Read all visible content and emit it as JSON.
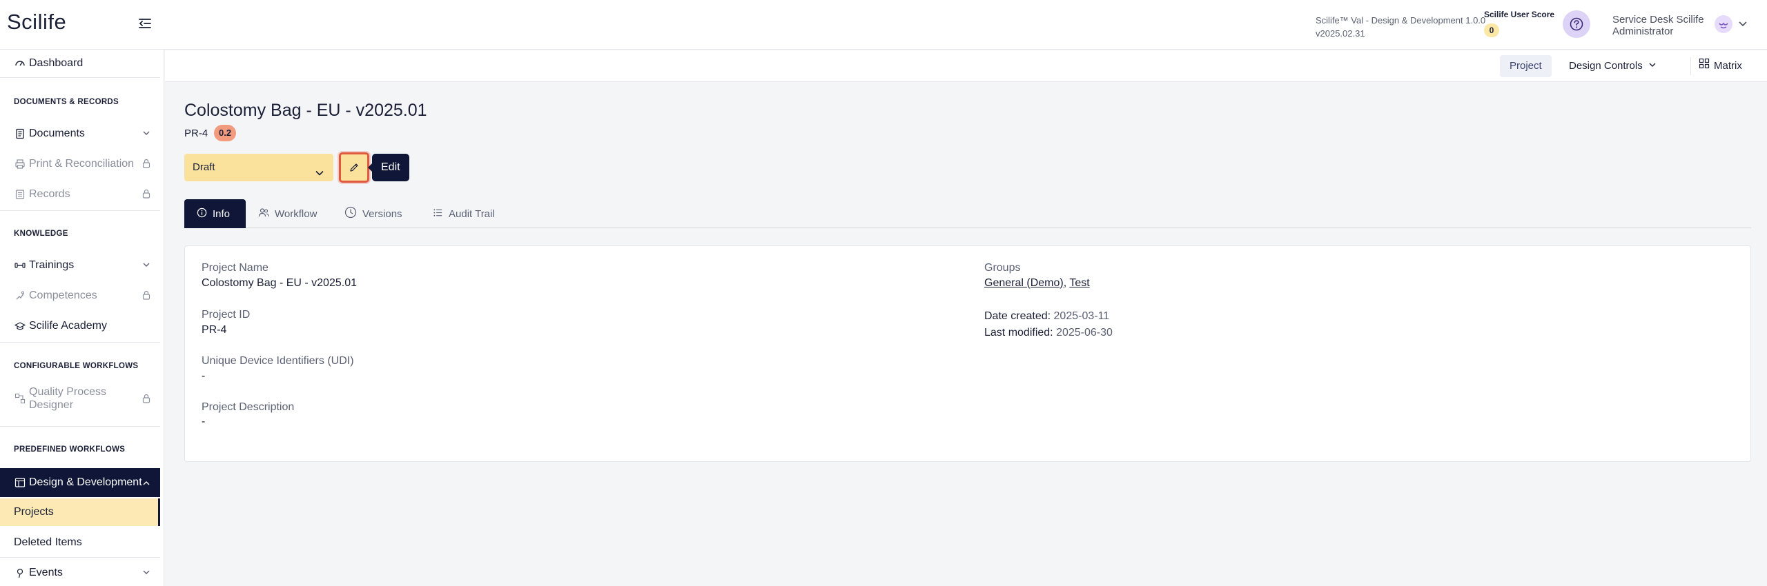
{
  "header": {
    "logo": "Scilife",
    "app_name": "Scilife™ Val - Design & Development 1.0.0",
    "app_version": "v2025.02.31",
    "score_label": "Scilife User Score",
    "score_value": "0",
    "user_line1": "Service Desk Scilife",
    "user_line2": "Administrator"
  },
  "sidebar": {
    "dashboard": "Dashboard",
    "sec_docs": "DOCUMENTS & RECORDS",
    "documents": "Documents",
    "print_recon": "Print & Reconciliation",
    "records": "Records",
    "sec_knowledge": "KNOWLEDGE",
    "trainings": "Trainings",
    "competences": "Competences",
    "academy": "Scilife Academy",
    "sec_config": "CONFIGURABLE WORKFLOWS",
    "qpd_line1": "Quality Process",
    "qpd_line2": "Designer",
    "sec_predef": "PREDEFINED WORKFLOWS",
    "design_dev": "Design & Development",
    "projects": "Projects",
    "deleted_items": "Deleted Items",
    "events": "Events"
  },
  "subbar": {
    "project": "Project",
    "design_controls": "Design Controls",
    "matrix": "Matrix"
  },
  "page": {
    "title": "Colostomy Bag - EU - v2025.01",
    "code": "PR-4",
    "version": "0.2",
    "status": "Draft",
    "edit_tooltip": "Edit"
  },
  "tabs": {
    "info": "Info",
    "workflow": "Workflow",
    "versions": "Versions",
    "audit": "Audit Trail"
  },
  "info": {
    "project_name_label": "Project Name",
    "project_name": "Colostomy Bag - EU - v2025.01",
    "project_id_label": "Project ID",
    "project_id": "PR-4",
    "udi_label": "Unique Device Identifiers (UDI)",
    "udi": "-",
    "desc_label": "Project Description",
    "desc": "-",
    "groups_label": "Groups",
    "group1": "General (Demo)",
    "group_sep": ", ",
    "group2": "Test",
    "created_label": "Date created:",
    "created": "2025-03-11",
    "modified_label": "Last modified:",
    "modified": "2025-06-30"
  },
  "colors": {
    "navy": "#0f1638",
    "draft_yellow": "#fbe29c",
    "version_orange": "#f29b7e",
    "highlight_red": "#e0593e"
  }
}
